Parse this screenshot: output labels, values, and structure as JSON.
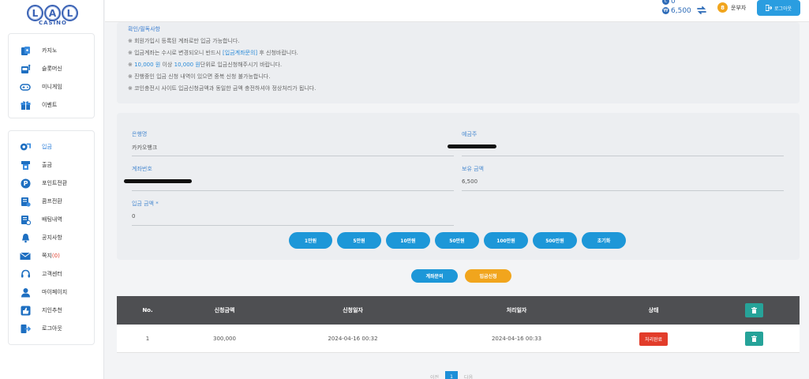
{
  "logo": {
    "letters": [
      "L",
      "A",
      "L"
    ],
    "sub": "CASINO"
  },
  "sidebar": {
    "group1": [
      {
        "label": "카지노",
        "icon": "casino-icon"
      },
      {
        "label": "슬롯머신",
        "icon": "slot-machine-icon"
      },
      {
        "label": "미니게임",
        "icon": "gamepad-icon"
      },
      {
        "label": "이벤트",
        "icon": "gift-icon"
      }
    ],
    "group2": [
      {
        "label": "입금",
        "icon": "deposit-icon",
        "active": true
      },
      {
        "label": "출금",
        "icon": "withdraw-icon"
      },
      {
        "label": "포인트전환",
        "icon": "point-icon"
      },
      {
        "label": "콤프전환",
        "icon": "comp-icon"
      },
      {
        "label": "배팅내역",
        "icon": "betting-history-icon"
      },
      {
        "label": "공지사항",
        "icon": "bell-icon"
      },
      {
        "label": "쪽지",
        "icon": "mail-icon",
        "badge": "(0)"
      },
      {
        "label": "고객센터",
        "icon": "headset-icon"
      },
      {
        "label": "마이페이지",
        "icon": "user-icon"
      },
      {
        "label": "지인추천",
        "icon": "thumbs-up-icon"
      },
      {
        "label": "로그아웃",
        "icon": "logout-icon"
      }
    ]
  },
  "topbar": {
    "coin_value": "0",
    "balance": "6,500",
    "username": "운부자",
    "level": "8",
    "logout_label": "로그아웃"
  },
  "notice": {
    "title": "확인/필독사항",
    "lines": [
      {
        "text": "※ 회원가입시 등록된 계좌로만 입금 가능합니다."
      },
      {
        "pre": "※ 입금계좌는 수시로 변경되오니 반드시 ",
        "hl": "[입금계좌문의]",
        "post": " 후 신청바랍니다."
      },
      {
        "pre": "※ ",
        "hl": "10,000 원",
        "mid": " 이상 ",
        "hl2": "10,000 원",
        "post": "단위로 입금신청해주시기 바랍니다."
      },
      {
        "text": "※ 진행중인 입금 신청 내역이 있으면 중복 신청 불가능합니다."
      },
      {
        "text": "※ 코인충전시 사이트 입금신청금액과 동일한 금액 충전하셔야 정상처리가 됩니다."
      }
    ]
  },
  "form": {
    "bank_label": "은행명",
    "bank_value": "카카오뱅크",
    "holder_label": "예금주",
    "account_label": "계좌번호",
    "balance_label": "보유 금액",
    "balance_value": "6,500",
    "amount_label": "입금 금액 *",
    "amount_value": "0",
    "amount_buttons": [
      "1만원",
      "5만원",
      "10만원",
      "50만원",
      "100만원",
      "500만원",
      "초기화"
    ]
  },
  "actions": {
    "inquiry_label": "계좌문의",
    "apply_label": "입금신청"
  },
  "table": {
    "headers": [
      "No.",
      "신청금액",
      "신청일자",
      "처리일자",
      "상태"
    ],
    "rows": [
      {
        "no": "1",
        "amount": "300,000",
        "applied": "2024-04-16 00:32",
        "processed": "2024-04-16 00:33",
        "status": "처리완료"
      }
    ]
  },
  "pager": {
    "prev": "이전",
    "current": "1",
    "next": "다음"
  },
  "colors": {
    "accent": "#1d97d8",
    "apply": "#f1a51d",
    "status": "#e23c2a",
    "trash": "#26a399"
  }
}
